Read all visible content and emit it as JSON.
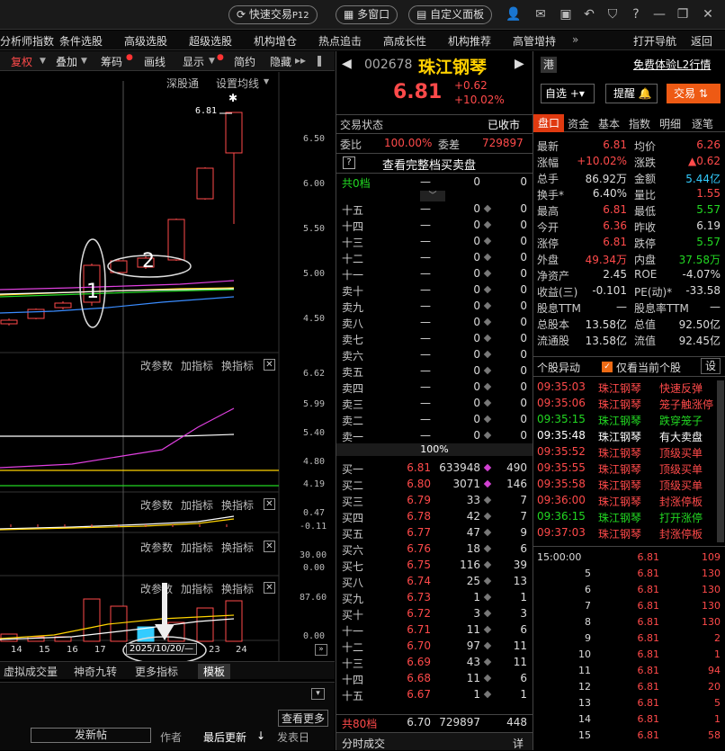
{
  "titlebar": {
    "quick_trade": "快速交易",
    "quick_trade_key": "P12",
    "multi_window": "多窗口",
    "custom_panel": "自定义面板"
  },
  "menu": {
    "items": [
      "分析师指数",
      "条件选股",
      "高级选股",
      "超级选股",
      "机构增仓",
      "热点追击",
      "高成长性",
      "机构推荐",
      "高管增持"
    ],
    "open_nav": "打开导航",
    "back": "返回"
  },
  "chart_toolbar": {
    "items": [
      "复权",
      "叠加",
      "筹码",
      "画线",
      "显示",
      "简约",
      "隐藏"
    ],
    "deep_link": "深股通",
    "ma_setting": "设置均线"
  },
  "chart": {
    "y_main": [
      "6.50",
      "6.00",
      "5.50",
      "5.00",
      "4.50"
    ],
    "last_label": "6.81",
    "annotations": [
      "1",
      "2"
    ],
    "panel_menu": {
      "params": "改参数",
      "add": "加指标",
      "swap": "换指标",
      "close": "✕"
    },
    "y_p2": [
      "6.62",
      "5.99",
      "5.40",
      "4.80",
      "4.19"
    ],
    "y_p3": [
      "0.47",
      "-0.11"
    ],
    "y_p4": [
      "30.00",
      "0.00"
    ],
    "y_p5": [
      "87.60",
      "0.00"
    ],
    "x_dates": [
      "14",
      "15",
      "16",
      "17",
      "23",
      "24"
    ],
    "cursor_date": "2025/10/20/—",
    "candles": [
      {
        "o": 4.46,
        "c": 4.5,
        "h": 4.52,
        "l": 4.44
      },
      {
        "o": 4.52,
        "c": 4.62,
        "h": 4.63,
        "l": 4.51
      },
      {
        "o": 4.64,
        "c": 4.69,
        "h": 4.71,
        "l": 4.62
      },
      {
        "o": 4.7,
        "c": 5.11,
        "h": 5.13,
        "l": 4.66
      },
      {
        "o": 5.03,
        "c": 5.16,
        "h": 5.18,
        "l": 5.02
      },
      {
        "o": 5.09,
        "c": 5.19,
        "h": 5.21,
        "l": 5.07
      },
      {
        "o": 5.17,
        "c": 5.62,
        "h": 5.63,
        "l": 5.16
      },
      {
        "o": 5.85,
        "c": 6.19,
        "h": 6.2,
        "l": 5.84
      },
      {
        "o": 6.36,
        "c": 6.81,
        "h": 6.81,
        "l": 5.57
      }
    ]
  },
  "bottom_tabs": [
    "虚拟成交量",
    "神奇九转",
    "更多指标",
    "模板"
  ],
  "news": {
    "view_more": "查看更多",
    "post": "发新帖",
    "author": "作者",
    "last_update": "最后更新",
    "post_date": "发表日"
  },
  "quote": {
    "code": "002678",
    "name": "珠江钢琴",
    "price": "6.81",
    "change": "+0.62",
    "pct": "+10.02%",
    "hk": "港",
    "free_l2": "免费体验L2行情",
    "watch": "自选",
    "alert": "提醒",
    "trade": "交易",
    "status_label": "交易状态",
    "status": "已收市",
    "wb_label": "委比",
    "wb": "100.00%",
    "wc_label": "委差",
    "wc": "729897",
    "full_book": "查看完整档买卖盘",
    "total0_label": "共0档",
    "total0_a": "—",
    "total0_b": "0",
    "total0_c": "0",
    "sell": [
      {
        "n": "十五",
        "p": "—",
        "v": "0",
        "c": "0"
      },
      {
        "n": "十四",
        "p": "—",
        "v": "0",
        "c": "0"
      },
      {
        "n": "十三",
        "p": "—",
        "v": "0",
        "c": "0"
      },
      {
        "n": "十二",
        "p": "—",
        "v": "0",
        "c": "0"
      },
      {
        "n": "十一",
        "p": "—",
        "v": "0",
        "c": "0"
      },
      {
        "n": "卖十",
        "p": "—",
        "v": "0",
        "c": "0"
      },
      {
        "n": "卖九",
        "p": "—",
        "v": "0",
        "c": "0"
      },
      {
        "n": "卖八",
        "p": "—",
        "v": "0",
        "c": "0"
      },
      {
        "n": "卖七",
        "p": "—",
        "v": "0",
        "c": "0"
      },
      {
        "n": "卖六",
        "p": "—",
        "v": "0",
        "c": "0"
      },
      {
        "n": "卖五",
        "p": "—",
        "v": "0",
        "c": "0"
      },
      {
        "n": "卖四",
        "p": "—",
        "v": "0",
        "c": "0"
      },
      {
        "n": "卖三",
        "p": "—",
        "v": "0",
        "c": "0"
      },
      {
        "n": "卖二",
        "p": "—",
        "v": "0",
        "c": "0"
      },
      {
        "n": "卖一",
        "p": "—",
        "v": "0",
        "c": "0"
      }
    ],
    "ratio": "100%",
    "buy": [
      {
        "n": "买一",
        "p": "6.81",
        "v": "633948",
        "c": "490"
      },
      {
        "n": "买二",
        "p": "6.80",
        "v": "3071",
        "c": "146"
      },
      {
        "n": "买三",
        "p": "6.79",
        "v": "33",
        "c": "7"
      },
      {
        "n": "买四",
        "p": "6.78",
        "v": "42",
        "c": "7"
      },
      {
        "n": "买五",
        "p": "6.77",
        "v": "47",
        "c": "9"
      },
      {
        "n": "买六",
        "p": "6.76",
        "v": "18",
        "c": "6"
      },
      {
        "n": "买七",
        "p": "6.75",
        "v": "116",
        "c": "39"
      },
      {
        "n": "买八",
        "p": "6.74",
        "v": "25",
        "c": "13"
      },
      {
        "n": "买九",
        "p": "6.73",
        "v": "1",
        "c": "1"
      },
      {
        "n": "买十",
        "p": "6.72",
        "v": "3",
        "c": "3"
      },
      {
        "n": "十一",
        "p": "6.71",
        "v": "11",
        "c": "6"
      },
      {
        "n": "十二",
        "p": "6.70",
        "v": "97",
        "c": "11"
      },
      {
        "n": "十三",
        "p": "6.69",
        "v": "43",
        "c": "11"
      },
      {
        "n": "十四",
        "p": "6.68",
        "v": "11",
        "c": "6"
      },
      {
        "n": "十五",
        "p": "6.67",
        "v": "1",
        "c": "1"
      }
    ],
    "total80_label": "共80档",
    "total80_p": "6.70",
    "total80_v": "729897",
    "total80_c": "448",
    "fenshi": "分时成交",
    "detail": "详"
  },
  "panel": {
    "tabs": [
      "盘口",
      "资金",
      "基本",
      "指数",
      "明细",
      "逐笔"
    ],
    "stats": [
      [
        "最新",
        "6.81",
        "均价",
        "6.26"
      ],
      [
        "涨幅",
        "+10.02%",
        "涨跌",
        "▲0.62"
      ],
      [
        "总手",
        "86.92万",
        "金额",
        "5.44亿"
      ],
      [
        "换手*",
        "6.40%",
        "量比",
        "1.55"
      ],
      [
        "最高",
        "6.81",
        "最低",
        "5.57"
      ],
      [
        "今开",
        "6.36",
        "昨收",
        "6.19"
      ],
      [
        "涨停",
        "6.81",
        "跌停",
        "5.57"
      ],
      [
        "外盘",
        "49.34万",
        "内盘",
        "37.58万"
      ],
      [
        "净资产",
        "2.45",
        "ROE",
        "-4.07%"
      ],
      [
        "收益(三)",
        "-0.101",
        "PE(动)*",
        "-33.58"
      ],
      [
        "股息TTM",
        "—",
        "股息率TTM",
        "—"
      ],
      [
        "总股本",
        "13.58亿",
        "总值",
        "92.50亿"
      ],
      [
        "流通股",
        "13.58亿",
        "流值",
        "92.45亿"
      ]
    ],
    "anomaly_title": "个股异动",
    "only_current": "仅看当前个股",
    "settings": "设",
    "alerts": [
      {
        "t": "09:35:03",
        "n": "珠江钢琴",
        "e": "快速反弹",
        "c": "red"
      },
      {
        "t": "09:35:06",
        "n": "珠江钢琴",
        "e": "笼子触涨停",
        "c": "red"
      },
      {
        "t": "09:35:15",
        "n": "珠江钢琴",
        "e": "跌穿笼子",
        "c": "grn"
      },
      {
        "t": "09:35:48",
        "n": "珠江钢琴",
        "e": "有大卖盘",
        "c": "wht"
      },
      {
        "t": "09:35:52",
        "n": "珠江钢琴",
        "e": "顶级买单",
        "c": "red"
      },
      {
        "t": "09:35:55",
        "n": "珠江钢琴",
        "e": "顶级买单",
        "c": "red"
      },
      {
        "t": "09:35:58",
        "n": "珠江钢琴",
        "e": "顶级买单",
        "c": "red"
      },
      {
        "t": "09:36:00",
        "n": "珠江钢琴",
        "e": "封涨停板",
        "c": "red"
      },
      {
        "t": "09:36:15",
        "n": "珠江钢琴",
        "e": "打开涨停",
        "c": "grn"
      },
      {
        "t": "09:37:03",
        "n": "珠江钢琴",
        "e": "封涨停板",
        "c": "red"
      }
    ],
    "ticks": [
      {
        "t": "15:00:00",
        "p": "6.81",
        "v": "109"
      },
      {
        "t": "5",
        "p": "6.81",
        "v": "130"
      },
      {
        "t": "6",
        "p": "6.81",
        "v": "130"
      },
      {
        "t": "7",
        "p": "6.81",
        "v": "130"
      },
      {
        "t": "8",
        "p": "6.81",
        "v": "130"
      },
      {
        "t": "9",
        "p": "6.81",
        "v": "2"
      },
      {
        "t": "10",
        "p": "6.81",
        "v": "1"
      },
      {
        "t": "11",
        "p": "6.81",
        "v": "94"
      },
      {
        "t": "12",
        "p": "6.81",
        "v": "20"
      },
      {
        "t": "13",
        "p": "6.81",
        "v": "5"
      },
      {
        "t": "14",
        "p": "6.81",
        "v": "1"
      },
      {
        "t": "15",
        "p": "6.81",
        "v": "58"
      }
    ]
  },
  "colors": {
    "up": "#ff4a4a",
    "down": "#22d722",
    "ma1": "#ffffff",
    "ma2": "#ffd400",
    "ma3": "#e040e0",
    "ma4": "#3a8cff",
    "ma5": "#22d722"
  }
}
